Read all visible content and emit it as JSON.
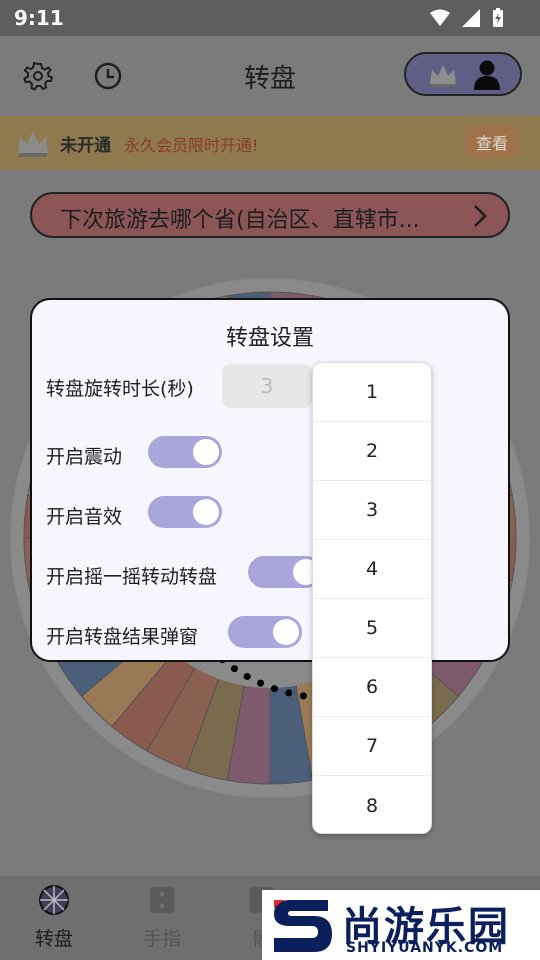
{
  "status": {
    "time": "9:11"
  },
  "header": {
    "title": "转盘"
  },
  "banner": {
    "status": "未开通",
    "promo": "永久会员限时开通!",
    "button": "查看"
  },
  "question": {
    "text": "下次旅游去哪个省(自治区、直辖市..."
  },
  "dialog": {
    "title": "转盘设置",
    "duration_label": "转盘旋转时长(秒)",
    "duration_value": "3",
    "rows": [
      {
        "label": "开启震动",
        "on": true
      },
      {
        "label": "开启音效",
        "on": true
      },
      {
        "label": "开启摇一摇转动转盘",
        "on": true
      },
      {
        "label": "开启转盘结果弹窗",
        "on": true
      }
    ]
  },
  "dropdown": {
    "options": [
      "1",
      "2",
      "3",
      "4",
      "5",
      "6",
      "7",
      "8"
    ]
  },
  "bottom_nav": [
    {
      "label": "转盘",
      "icon": "wheel-icon"
    },
    {
      "label": "手指",
      "icon": "dice-icon"
    },
    {
      "label": "骰",
      "icon": "dice-icon"
    }
  ],
  "watermark": {
    "main": "尚游乐园",
    "sub": "SHYIYUANYK.COM"
  },
  "colors": {
    "accent": "#a9a6dc",
    "banner_bg": "#8f7a50",
    "question_bg": "#8c5656"
  }
}
